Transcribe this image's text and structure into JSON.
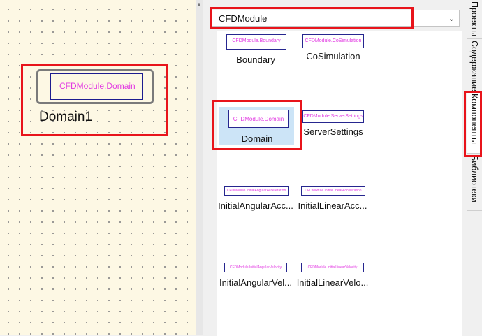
{
  "canvas": {
    "block": {
      "type_label": "CFDModule.Domain",
      "instance_name": "Domain1"
    }
  },
  "library": {
    "selector": {
      "value": "CFDModule"
    },
    "items": [
      {
        "name": "Boundary",
        "thumb_text": "CFDModule.Boundary"
      },
      {
        "name": "CoSimulation",
        "thumb_text": "CFDModule.CoSimulation"
      },
      {
        "name": "Domain",
        "thumb_text": "CFDModule.Domain",
        "selected": true
      },
      {
        "name": "ServerSettings",
        "thumb_text": "CFDModule.ServerSettings"
      },
      {
        "name": "InitialAngularAcc...",
        "thumb_text": "CFDModule.InitialAngularAcceleration"
      },
      {
        "name": "InitialLinearAcc...",
        "thumb_text": "CFDModule.InitialLinearAcceleration"
      },
      {
        "name": "InitialAngularVel...",
        "thumb_text": "CFDModule.InitialAngularVelocity"
      },
      {
        "name": "InitialLinearVelo...",
        "thumb_text": "CFDModule.InitialLinearVelocity"
      }
    ]
  },
  "side_tabs": [
    {
      "label": "Проекты"
    },
    {
      "label": "Содержание"
    },
    {
      "label": "Компоненты",
      "active": true
    },
    {
      "label": "Библиотеки"
    }
  ],
  "colors": {
    "highlight": "#e8141b",
    "selection": "#cce4f7",
    "thumb_text": "#e23ae2",
    "canvas_bg": "#fdf8e4"
  }
}
